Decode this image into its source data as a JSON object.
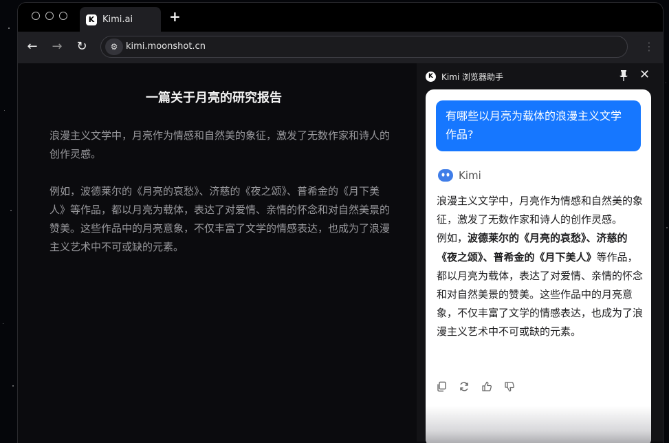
{
  "browser": {
    "tab_title": "Kimi.ai",
    "tab_icon_letter": "K",
    "new_tab_symbol": "+",
    "url": "kimi.moonshot.cn"
  },
  "article": {
    "title": "一篇关于月亮的研究报告",
    "paragraphs": [
      "浪漫主义文学中，月亮作为情感和自然美的象征，激发了无数作家和诗人的创作灵感。",
      "例如，波德莱尔的《月亮的哀愁》、济慈的《夜之颂》、普希金的《月下美人》等作品，都以月亮为载体，表达了对爱情、亲情的怀念和对自然美景的赞美。这些作品中的月亮意象，不仅丰富了文学的情感表达，也成为了浪漫主义艺术中不可或缺的元素。"
    ]
  },
  "panel": {
    "title": "Kimi 浏览器助手",
    "user_question": "有哪些以月亮为载体的浪漫主义文学作品?",
    "assistant_name": "Kimi",
    "answer_p1": "浪漫主义文学中，月亮作为情感和自然美的象征，激发了无数作家和诗人的创作灵感。",
    "answer_p2_intro": "例如，",
    "answer_p2_highlight": "波德莱尔的《月亮的哀愁》、济慈的《夜之颂》、普希金的《月下美人》",
    "answer_p2_rest": "等作品，都以月亮为载体，表达了对爱情、亲情的怀念和对自然美景的赞美。这些作品中的月亮意象，不仅丰富了文学的情感表达，也成为了浪漫主义艺术中不可或缺的元素。"
  },
  "colors": {
    "accent": "#1677ff",
    "panel_bg": "#131316",
    "page_bg": "#0b0b0e"
  }
}
